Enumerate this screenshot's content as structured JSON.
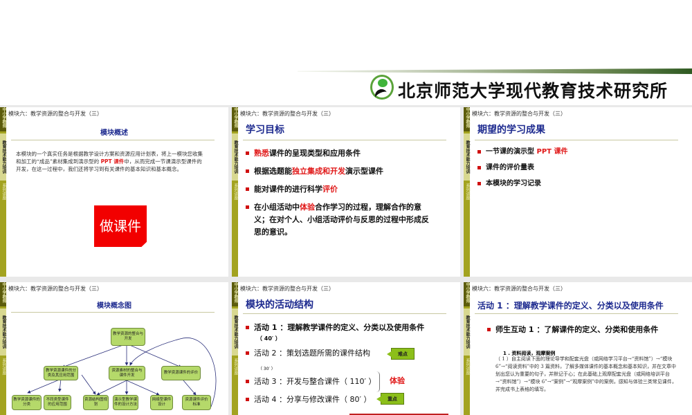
{
  "org_name": "北京师范大学现代教育技术研究所",
  "sidebar": {
    "part1": "中小学教师",
    "part2": "教育技术能力培训",
    "part3": "系列讲座"
  },
  "header": "模块六：教学资源的整合与开发（三）",
  "slides": [
    {
      "title": "模块概述",
      "paragraph_pre": "本模块的一个真实任务是根据教学设计方案和资源应用计划表，将上一模块您收集和加工的“成品”素材集成到演示型的 ",
      "paragraph_highlight": "PPT 课件",
      "paragraph_post": "中，从而完成一节课演示型课件的开发，在这一过程中，我们还将学习到有关课件的基本知识和基本概念。",
      "button_label": "做课件"
    },
    {
      "title": "学习目标",
      "items": [
        {
          "a": "",
          "hl": "熟悉",
          "b": "课件的呈现类型和应用条件"
        },
        {
          "a": "根据选题能",
          "hl": "独立集成和开发",
          "b": "演示型课件"
        },
        {
          "a": "能对课件的进行科学",
          "hl": "评价",
          "b": ""
        },
        {
          "a": "在小组活动中",
          "hl": "体验",
          "b": "合作学习的过程，理解合作的意义；在对个人、小组活动评价与反思的过程中形成反思的意识。"
        }
      ]
    },
    {
      "title": "期望的学习成果",
      "items": [
        {
          "a": "一节课的演示型 ",
          "hl": "PPT 课件"
        },
        {
          "a": "课件的评价量表",
          "hl": ""
        },
        {
          "a": "本模块的学习记录",
          "hl": ""
        }
      ]
    },
    {
      "title": "模块概念图",
      "nodes": [
        "教学资源的整合与开发",
        "教学资源课件的分类及其应用范围",
        "资源素材的整合与课件开发",
        "教学资源课件的评价",
        "教学资源课件的分类",
        "不同类型课件的应用范围",
        "资源结构图规划",
        "演示型教学课件的设计方法",
        "网络型课件设计",
        "资源课件评价标准"
      ]
    },
    {
      "title": "模块的活动结构",
      "activities": [
        {
          "label": "活动 1 ：理解教学课件的定义、分类以及使用条件",
          "time": "（ 40′ ）"
        },
        {
          "label": "活动 2 ：策划选题所需的课件结构",
          "time": "（ 30′ ）",
          "tag": "难点"
        },
        {
          "label": "活动 3 ：开发与整合课件（ 110′ ）",
          "note": "体验"
        },
        {
          "label": "活动 4 ：分享与修改课件（ 80′ ）",
          "tag": "重点"
        }
      ]
    },
    {
      "title": "活动 1 ：理解教学课件的定义、分类以及使用条件",
      "bullet": "师生互动 1 ：了解课件的定义、分类和使用条件",
      "subhead": "1 . 资料阅读，观摩案例",
      "paragraph": "（ 1 ）自主阅读下面的理论导学和配套光盘（或网络学习平台→“资料馆”）→“模块 6”→“阅读资料”中的 3 篇资料，了解多媒体课件的基本概念和基本知识，并在文章中划出您认为重要的句子，并默记于心；在此基础上观摩配套光盘（或网络培训平台→“资料馆”）→“模块 6”→“案例”→“观摩案例”中的案例，感知与体验三类常见课件，并完成书上表格的填写。"
    }
  ]
}
